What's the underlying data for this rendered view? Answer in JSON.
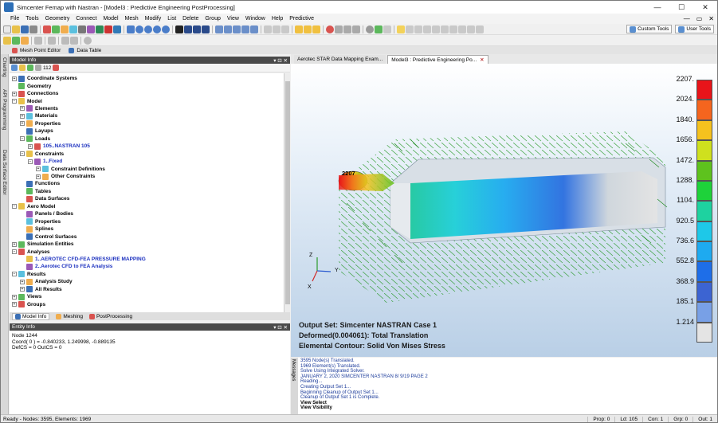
{
  "window": {
    "title": "Simcenter Femap with Nastran - [Model3 : Predictive Engineering PostProcessing]",
    "minimize": "—",
    "restore": "☐",
    "close": "✕"
  },
  "menu": {
    "items": [
      "File",
      "Tools",
      "Geometry",
      "Connect",
      "Model",
      "Mesh",
      "Modify",
      "List",
      "Delete",
      "Group",
      "View",
      "Window",
      "Help",
      "Predictive"
    ],
    "right_controls": [
      "—",
      "▭",
      "✕"
    ]
  },
  "toolbar": {
    "custom_tools": "Custom Tools",
    "user_tools": "User Tools"
  },
  "doc_tabs": [
    "Mesh Point Editor",
    "Data Table"
  ],
  "side_tabs": [
    "Charting",
    "API Programming",
    "Data Surface Editor"
  ],
  "model_info": {
    "header": "Model Info",
    "toolbar_text": "112",
    "tree": [
      {
        "label": "Coordinate Systems",
        "indent": 0,
        "expander": "+"
      },
      {
        "label": "Geometry",
        "indent": 0,
        "expander": ""
      },
      {
        "label": "Connections",
        "indent": 0,
        "expander": "+"
      },
      {
        "label": "Model",
        "indent": 0,
        "expander": "−"
      },
      {
        "label": "Elements",
        "indent": 1,
        "expander": "+"
      },
      {
        "label": "Materials",
        "indent": 1,
        "expander": "+"
      },
      {
        "label": "Properties",
        "indent": 1,
        "expander": "+"
      },
      {
        "label": "Layups",
        "indent": 1,
        "expander": ""
      },
      {
        "label": "Loads",
        "indent": 1,
        "expander": "−"
      },
      {
        "label": "105..NASTRAN 105",
        "indent": 2,
        "expander": "+",
        "blue": true
      },
      {
        "label": "Constraints",
        "indent": 1,
        "expander": "−"
      },
      {
        "label": "1..Fixed",
        "indent": 2,
        "expander": "−",
        "blue": true
      },
      {
        "label": "Constraint Definitions",
        "indent": 3,
        "expander": "+"
      },
      {
        "label": "Other Constraints",
        "indent": 3,
        "expander": "+"
      },
      {
        "label": "Functions",
        "indent": 1,
        "expander": ""
      },
      {
        "label": "Tables",
        "indent": 1,
        "expander": ""
      },
      {
        "label": "Data Surfaces",
        "indent": 1,
        "expander": ""
      },
      {
        "label": "Aero Model",
        "indent": 0,
        "expander": "−"
      },
      {
        "label": "Panels / Bodies",
        "indent": 1,
        "expander": ""
      },
      {
        "label": "Properties",
        "indent": 1,
        "expander": ""
      },
      {
        "label": "Splines",
        "indent": 1,
        "expander": ""
      },
      {
        "label": "Control Surfaces",
        "indent": 1,
        "expander": ""
      },
      {
        "label": "Simulation Entities",
        "indent": 0,
        "expander": "+"
      },
      {
        "label": "Analyses",
        "indent": 0,
        "expander": "−"
      },
      {
        "label": "1..AEROTEC CFD-FEA PRESSURE MAPPING",
        "indent": 1,
        "expander": "",
        "blue": true
      },
      {
        "label": "2..Aerotec CFD to FEA Analysis",
        "indent": 1,
        "expander": "",
        "blue": true
      },
      {
        "label": "Results",
        "indent": 0,
        "expander": "−"
      },
      {
        "label": "Analysis Study",
        "indent": 1,
        "expander": "+"
      },
      {
        "label": "All Results",
        "indent": 1,
        "expander": "+"
      },
      {
        "label": "Views",
        "indent": 0,
        "expander": "+"
      },
      {
        "label": "Groups",
        "indent": 0,
        "expander": "+"
      }
    ]
  },
  "bottom_tabs": [
    "Model Info",
    "Meshing",
    "PostProcessing"
  ],
  "entity_info": {
    "header": "Entity Info",
    "lines": [
      "Node 1244",
      "Coord( 0 ) = -0.840233, 1.249998, -0.889135",
      "DefCS = 0  OutCS = 0"
    ]
  },
  "view_tabs": [
    "Aerotec STAR Data Mapping Exam...",
    "Model3 : Predictive Engineering Po..."
  ],
  "viewport": {
    "output_set": "Output Set: Simcenter NASTRAN Case 1",
    "deformed": "Deformed(0.004061): Total Translation",
    "contour": "Elemental Contour: Solid Von Mises Stress",
    "tip_label": "2207",
    "axis_x": "X",
    "axis_y": "Y",
    "axis_z": "Z"
  },
  "legend": {
    "labels": [
      "2207.",
      "2024.",
      "1840.",
      "1656.",
      "1472.",
      "1288.",
      "1104.",
      "920.5",
      "736.6",
      "552.8",
      "368.9",
      "185.1",
      "1.214"
    ],
    "colors": [
      "#e8141a",
      "#f5651e",
      "#f5c21e",
      "#cfe01e",
      "#5ec21e",
      "#1ed23a",
      "#1ed2a0",
      "#1ec8e8",
      "#1eaaf0",
      "#1e6ee8",
      "#3c64d2",
      "#78a0e6",
      "#e4e4e4"
    ]
  },
  "messages": {
    "strip_label": "Messages",
    "lines": [
      {
        "text": "3595 Node(s) Translated.",
        "bold": false
      },
      {
        "text": "1969 Element(s) Translated.",
        "bold": false
      },
      {
        "text": "Solve Using Integrated Solver.",
        "bold": false
      },
      {
        "text": "JANUARY   2, 2020  SIMCENTER NASTRAN  8/ 9/19  PAGE    2",
        "bold": false
      },
      {
        "text": "Reading...",
        "bold": false
      },
      {
        "text": "Creating Output Set 1...",
        "bold": false
      },
      {
        "text": "Beginning Cleanup of Output Set 1...",
        "bold": false
      },
      {
        "text": "Cleanup of Output Set 1 is Complete.",
        "bold": false
      },
      {
        "text": "View Select",
        "bold": true
      },
      {
        "text": "View Visibility",
        "bold": true
      }
    ]
  },
  "status": {
    "left": "Ready - Nodes: 3595, Elements: 1969",
    "cells": [
      "Prop: 0",
      "Ld: 105",
      "Con: 1",
      "Grp: 0",
      "Out: 1"
    ]
  }
}
